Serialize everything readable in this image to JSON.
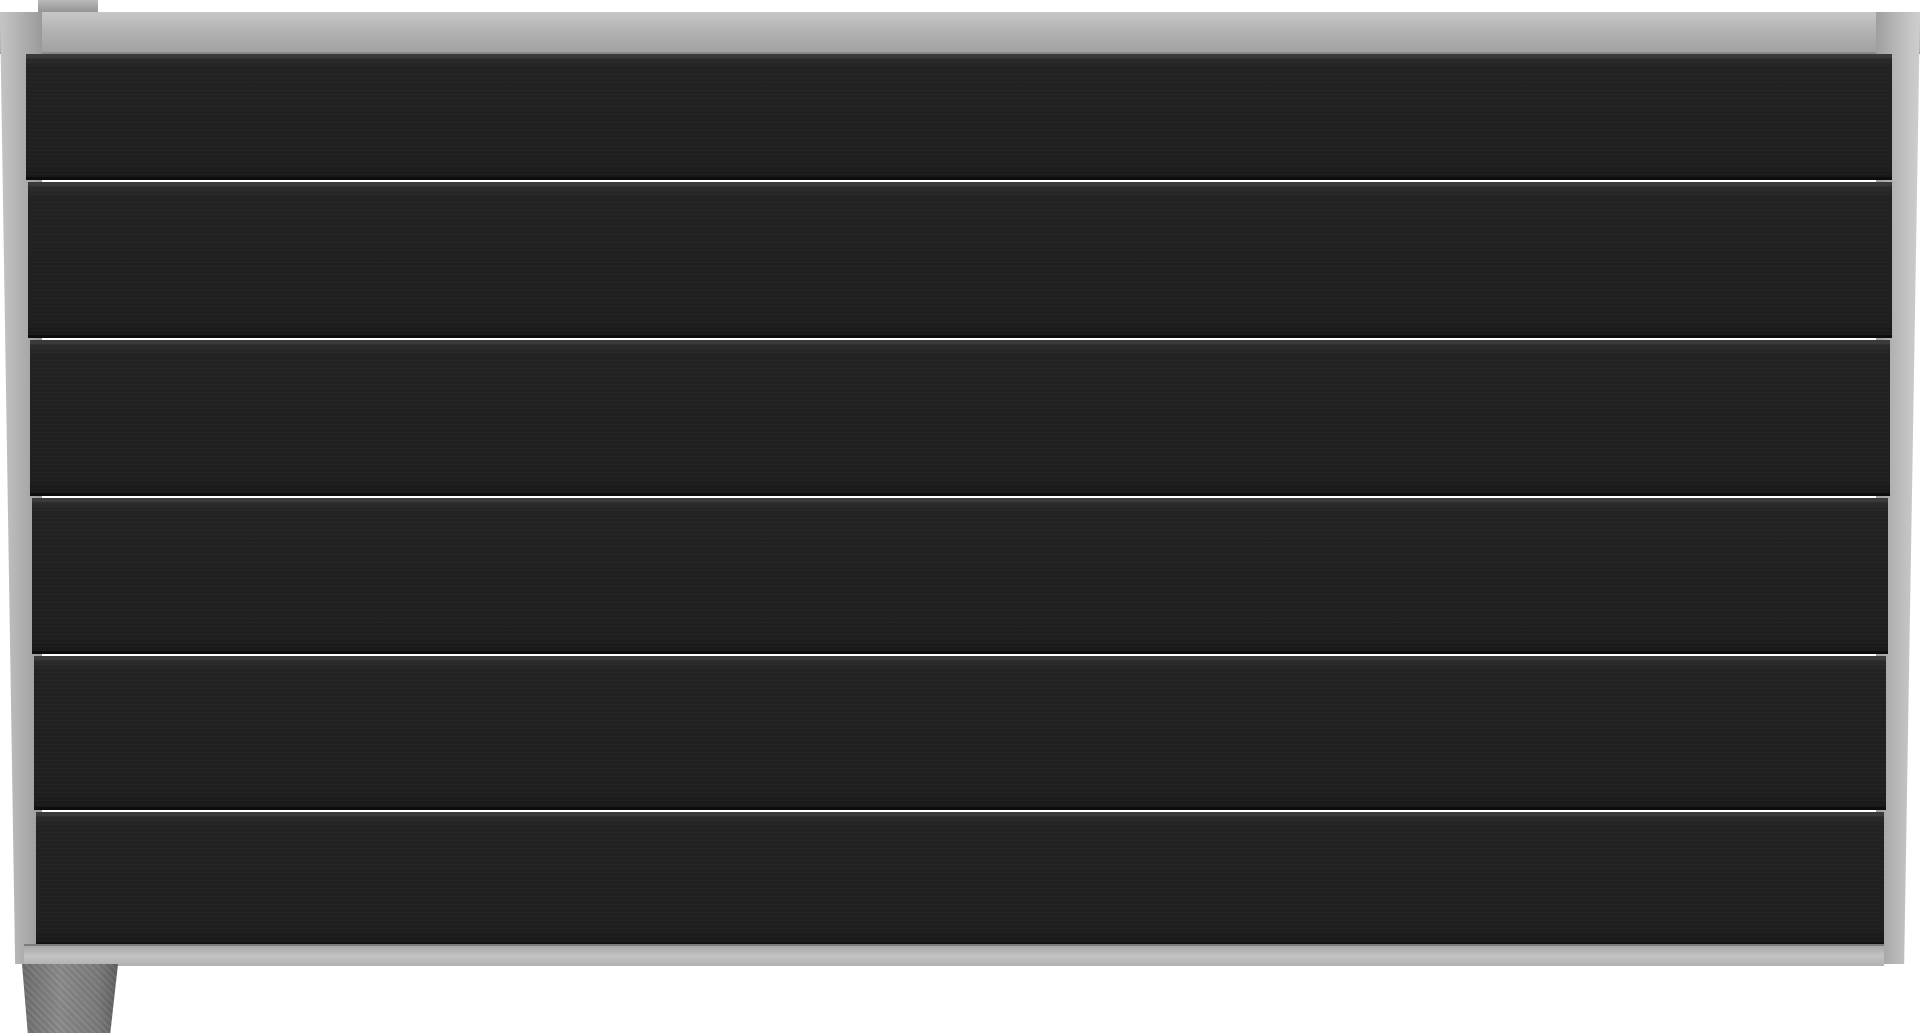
{
  "image": {
    "subject": "fence-panel",
    "colors": {
      "board": "#1f1f1f",
      "frame": "#b3b3b3",
      "concrete": "#7a7a7a",
      "background": "#ffffff"
    },
    "board_count": 6
  }
}
